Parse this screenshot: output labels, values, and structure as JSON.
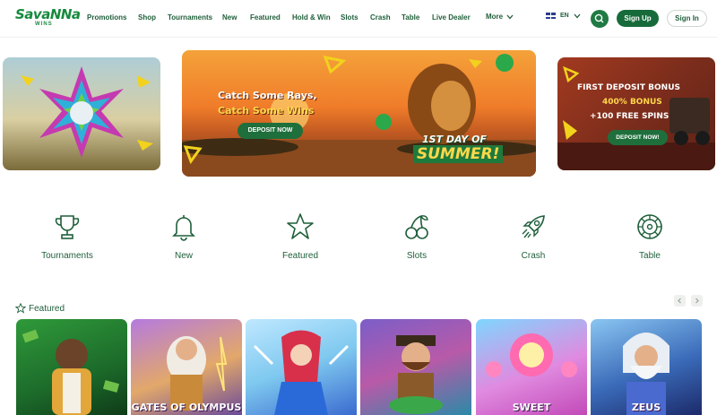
{
  "header": {
    "logo_text": "SavaNNa",
    "logo_sub": "WINS",
    "nav": [
      "Promotions",
      "Shop",
      "Tournaments",
      "New",
      "Featured",
      "Hold & Win",
      "Slots",
      "Crash",
      "Table",
      "Live Dealer"
    ],
    "more_label": "More",
    "language": "EN",
    "signup_label": "Sign Up",
    "signin_label": "Sign In"
  },
  "banners": {
    "middle": {
      "line1": "Catch Some Rays,",
      "line2": "Catch Some Wins",
      "button": "DEPOSIT NOW",
      "tag1": "1ST DAY OF",
      "tag2": "SUMMER!"
    },
    "right": {
      "line1": "FIRST DEPOSIT BONUS",
      "line2": "400% BONUS",
      "line3": "+100 FREE SPINS",
      "button": "DEPOSIT NOW!"
    }
  },
  "categories": [
    {
      "label": "Tournaments",
      "icon": "trophy-icon"
    },
    {
      "label": "New",
      "icon": "bell-icon"
    },
    {
      "label": "Featured",
      "icon": "star-icon"
    },
    {
      "label": "Slots",
      "icon": "cherry-icon"
    },
    {
      "label": "Crash",
      "icon": "rocket-icon"
    },
    {
      "label": "Table",
      "icon": "roulette-icon"
    }
  ],
  "featured": {
    "title": "Featured",
    "games": [
      {
        "title": ""
      },
      {
        "title": "GATES OF OLYMPUS"
      },
      {
        "title": ""
      },
      {
        "title": ""
      },
      {
        "title": "SWEET"
      },
      {
        "title": "ZEUS"
      }
    ]
  },
  "colors": {
    "brand": "#176b3a",
    "accent": "#ffd84a"
  }
}
